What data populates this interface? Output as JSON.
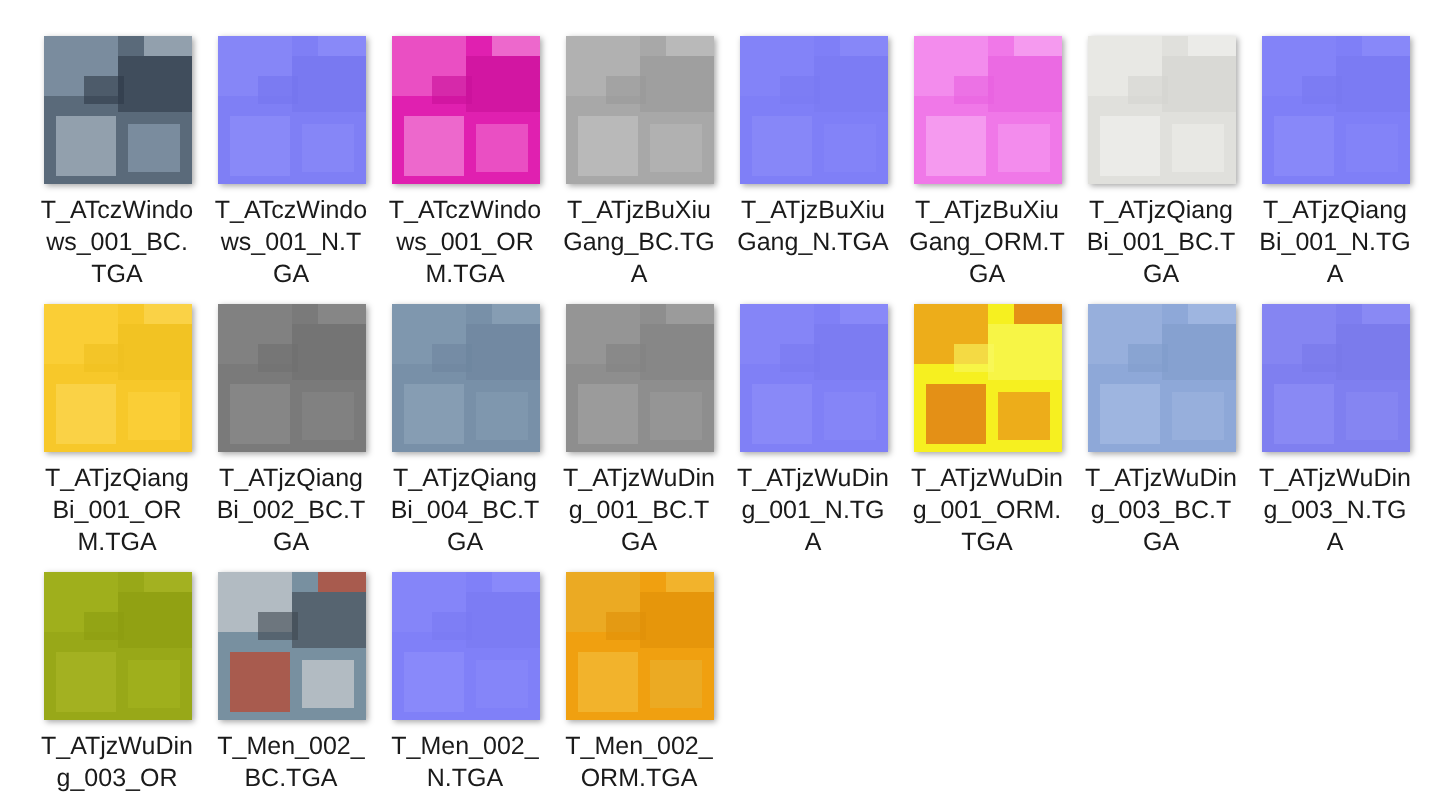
{
  "files": [
    {
      "name": "T_ATczWindows_001_BC.TGA",
      "kind": "picture"
    },
    {
      "name": "T_ATczWindows_001_N.TGA",
      "kind": "picture"
    },
    {
      "name": "T_ATczWindows_001_ORM.TGA",
      "kind": "picture"
    },
    {
      "name": "T_ATjzBuXiuGang_BC.TGA",
      "kind": "picture"
    },
    {
      "name": "T_ATjzBuXiuGang_N.TGA",
      "kind": "picture"
    },
    {
      "name": "T_ATjzBuXiuGang_ORM.TGA",
      "kind": "picture"
    },
    {
      "name": "T_ATjzQiangBi_001_BC.TGA",
      "kind": "picture"
    },
    {
      "name": "T_ATjzQiangBi_001_N.TGA",
      "kind": "picture"
    },
    {
      "name": "T_ATjzQiangBi_001_ORM.TGA",
      "kind": "picture"
    },
    {
      "name": "T_ATjzQiangBi_002_BC.TGA",
      "kind": "picture"
    },
    {
      "name": "T_ATjzQiangBi_004_BC.TGA",
      "kind": "picture"
    },
    {
      "name": "T_ATjzWuDing_001_BC.TGA",
      "kind": "picture"
    },
    {
      "name": "T_ATjzWuDing_001_N.TGA",
      "kind": "picture"
    },
    {
      "name": "T_ATjzWuDing_001_ORM.TGA",
      "kind": "picture"
    },
    {
      "name": "T_ATjzWuDing_003_BC.TGA",
      "kind": "picture"
    },
    {
      "name": "T_ATjzWuDing_003_N.TGA",
      "kind": "picture"
    },
    {
      "name": "T_ATjzWuDing_003_OR",
      "kind": "picture"
    },
    {
      "name": "T_Men_002_BC.TGA",
      "kind": "picture"
    },
    {
      "name": "T_Men_002_N.TGA",
      "kind": "picture"
    },
    {
      "name": "T_Men_002_ORM.TGA",
      "kind": "picture"
    }
  ]
}
